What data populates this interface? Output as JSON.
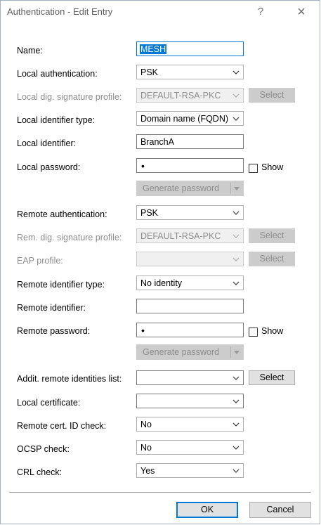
{
  "window": {
    "title": "Authentication - Edit Entry",
    "help_glyph": "?",
    "close_glyph": "×"
  },
  "form": {
    "name": {
      "label": "Name:",
      "value": "MESH"
    },
    "local_auth": {
      "label": "Local authentication:",
      "value": "PSK"
    },
    "local_sig_profile": {
      "label": "Local dig. signature profile:",
      "value": "DEFAULT-RSA-PKC",
      "button": "Select"
    },
    "local_id_type": {
      "label": "Local identifier type:",
      "value": "Domain name (FQDN)"
    },
    "local_id": {
      "label": "Local identifier:",
      "value": "BranchA"
    },
    "local_password": {
      "label": "Local password:",
      "mask": "•",
      "show_label": "Show",
      "show_checked": false
    },
    "gen_password_1": {
      "label": "Generate password"
    },
    "remote_auth": {
      "label": "Remote authentication:",
      "value": "PSK"
    },
    "rem_sig_profile": {
      "label": "Rem. dig. signature profile:",
      "value": "DEFAULT-RSA-PKC",
      "button": "Select"
    },
    "eap_profile": {
      "label": "EAP profile:",
      "value": "",
      "button": "Select"
    },
    "remote_id_type": {
      "label": "Remote identifier type:",
      "value": "No identity"
    },
    "remote_id": {
      "label": "Remote identifier:",
      "value": ""
    },
    "remote_password": {
      "label": "Remote password:",
      "mask": "•",
      "show_label": "Show",
      "show_checked": false
    },
    "gen_password_2": {
      "label": "Generate password"
    },
    "addit_remote_ids": {
      "label": "Addit. remote identities list:",
      "value": "",
      "button": "Select"
    },
    "local_cert": {
      "label": "Local certificate:",
      "value": ""
    },
    "remote_cert_check": {
      "label": "Remote cert. ID check:",
      "value": "No"
    },
    "ocsp_check": {
      "label": "OCSP check:",
      "value": "No"
    },
    "crl_check": {
      "label": "CRL check:",
      "value": "Yes"
    }
  },
  "footer": {
    "ok": "OK",
    "cancel": "Cancel"
  },
  "colors": {
    "accent": "#0078d7",
    "disabled_text": "#8d8d8d",
    "button_face": "#e1e1e1"
  }
}
